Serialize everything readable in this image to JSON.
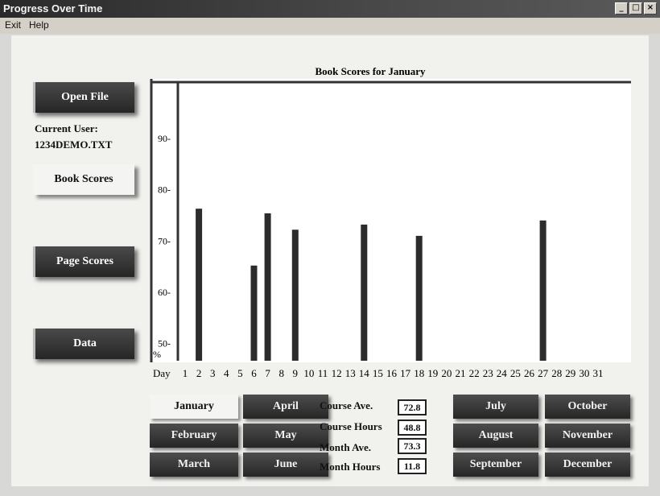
{
  "window": {
    "title": "Progress Over Time",
    "minimize_glyph": "_",
    "maximize_glyph": "□",
    "close_glyph": "×"
  },
  "menu": {
    "items": [
      "Exit",
      "Help"
    ]
  },
  "sidebar": {
    "open_file": "Open File",
    "current_user_label": "Current User:",
    "current_user_value": "1234DEMO.TXT",
    "book_scores": "Book Scores",
    "page_scores": "Page Scores",
    "data": "Data",
    "selected": "Book Scores"
  },
  "chart_data": {
    "type": "bar",
    "title": "Book Scores for January",
    "xlabel": "Day",
    "ylabel": "%",
    "ylim": [
      46,
      101
    ],
    "yticks": [
      50,
      60,
      70,
      80,
      90
    ],
    "categories": [
      "1",
      "2",
      "3",
      "4",
      "5",
      "6",
      "7",
      "8",
      "9",
      "10",
      "11",
      "12",
      "13",
      "14",
      "15",
      "16",
      "17",
      "18",
      "19",
      "20",
      "21",
      "22",
      "23",
      "24",
      "25",
      "26",
      "27",
      "28",
      "29",
      "30",
      "31"
    ],
    "values": [
      null,
      76.3,
      null,
      null,
      null,
      65.2,
      75.4,
      null,
      72.2,
      null,
      null,
      null,
      null,
      73.2,
      null,
      null,
      null,
      71.0,
      null,
      null,
      null,
      null,
      null,
      null,
      null,
      null,
      74.0,
      null,
      null,
      null,
      null
    ],
    "grid": false,
    "bar_color": "#2c2c2c"
  },
  "months": {
    "selected": "January",
    "col1": [
      "January",
      "February",
      "March"
    ],
    "col2": [
      "April",
      "May",
      "June"
    ],
    "col3": [
      "July",
      "August",
      "September"
    ],
    "col4": [
      "October",
      "November",
      "December"
    ]
  },
  "stats": {
    "course_ave_label": "Course Ave.",
    "course_ave": "72.8",
    "course_hours_label": "Course Hours",
    "course_hours": "48.8",
    "month_ave_label": "Month Ave.",
    "month_ave": "73.3",
    "month_hours_label": "Month Hours",
    "month_hours": "11.8"
  }
}
